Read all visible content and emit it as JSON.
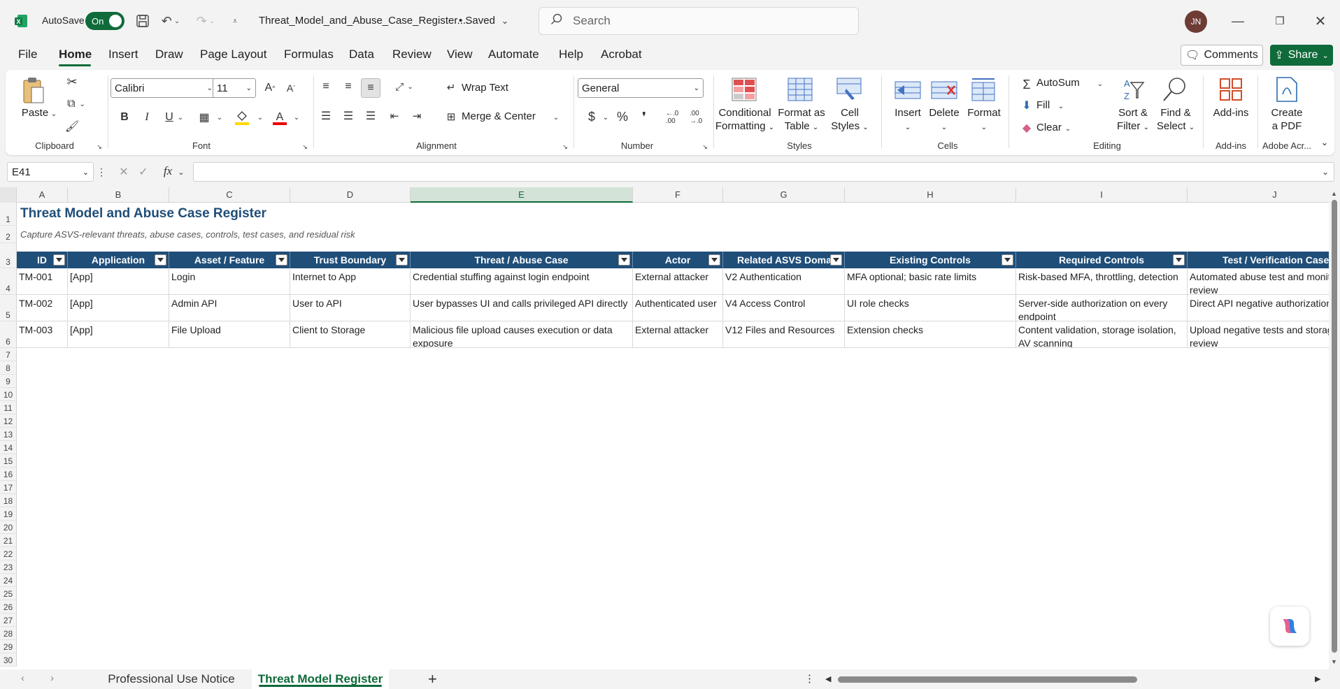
{
  "titlebar": {
    "autosave_label": "AutoSave",
    "autosave_state": "On",
    "filename": "Threat_Model_and_Abuse_Case_Register....",
    "save_status": "• Saved",
    "search_placeholder": "Search",
    "user_initials": "JN"
  },
  "menu": {
    "items": [
      "File",
      "Home",
      "Insert",
      "Draw",
      "Page Layout",
      "Formulas",
      "Data",
      "Review",
      "View",
      "Automate",
      "Help",
      "Acrobat"
    ],
    "active": "Home",
    "comments_label": "Comments",
    "share_label": "Share"
  },
  "ribbon": {
    "clipboard": {
      "paste": "Paste",
      "group": "Clipboard"
    },
    "font": {
      "name": "Calibri",
      "size": "11",
      "group": "Font",
      "bold": "B",
      "italic": "I",
      "underline": "U"
    },
    "alignment": {
      "wrap": "Wrap Text",
      "merge": "Merge & Center",
      "group": "Alignment"
    },
    "number": {
      "format": "General",
      "currency": "$",
      "percent": "%",
      "comma": "❜",
      "group": "Number"
    },
    "styles": {
      "conditional": [
        "Conditional",
        "Formatting"
      ],
      "format_table": [
        "Format as",
        "Table"
      ],
      "cell_styles": [
        "Cell",
        "Styles"
      ],
      "group": "Styles"
    },
    "cells": {
      "insert": "Insert",
      "delete": "Delete",
      "format": "Format",
      "group": "Cells"
    },
    "editing": {
      "autosum": "AutoSum",
      "fill": "Fill",
      "clear": "Clear",
      "sort": [
        "Sort &",
        "Filter"
      ],
      "find": [
        "Find &",
        "Select"
      ],
      "group": "Editing"
    },
    "addins": {
      "label": "Add-ins",
      "group": "Add-ins"
    },
    "acrobat": {
      "label": [
        "Create",
        "a PDF"
      ],
      "group": "Adobe Acr..."
    }
  },
  "formula_bar": {
    "name_box": "E41",
    "fx": "fx",
    "value": ""
  },
  "columns": [
    "A",
    "B",
    "C",
    "D",
    "E",
    "F",
    "G",
    "H",
    "I",
    "J"
  ],
  "selected_column": "E",
  "rows": [
    "1",
    "2",
    "3",
    "4",
    "5",
    "6",
    "7",
    "8",
    "9",
    "10",
    "11",
    "12",
    "13",
    "14",
    "15",
    "16",
    "17",
    "18",
    "19",
    "20",
    "21",
    "22",
    "23",
    "24",
    "25",
    "26",
    "27",
    "28",
    "29",
    "30"
  ],
  "sheet": {
    "title": "Threat Model and Abuse Case Register",
    "subtitle": "Capture ASVS-relevant threats, abuse cases, controls, test cases, and residual risk",
    "headers": [
      "ID",
      "Application",
      "Asset / Feature",
      "Trust Boundary",
      "Threat / Abuse Case",
      "Actor",
      "Related ASVS Domain",
      "Existing Controls",
      "Required Controls",
      "Test / Verification Case"
    ],
    "data": [
      [
        "TM-001",
        "[App]",
        "Login",
        "Internet to App",
        "Credential stuffing against login endpoint",
        "External attacker",
        "V2 Authentication",
        "MFA optional; basic rate limits",
        "Risk-based MFA, throttling, detection",
        "Automated abuse test and monitoring review"
      ],
      [
        "TM-002",
        "[App]",
        "Admin API",
        "User to API",
        "User bypasses UI and calls privileged API directly",
        "Authenticated user",
        "V4 Access Control",
        "UI role checks",
        "Server-side authorization on every endpoint",
        "Direct API negative authorization tests"
      ],
      [
        "TM-003",
        "[App]",
        "File Upload",
        "Client to Storage",
        "Malicious file upload causes execution or data exposure",
        "External attacker",
        "V12 Files and Resources",
        "Extension checks",
        "Content validation, storage isolation, AV scanning",
        "Upload negative tests and storage review"
      ]
    ]
  },
  "tabs": {
    "items": [
      "Professional Use Notice",
      "Threat Model Register"
    ],
    "active": "Threat Model Register",
    "add": "+"
  },
  "colors": {
    "accent": "#0f6b3a",
    "header_fill": "#1f4e79",
    "title_text": "#1f4e79"
  }
}
